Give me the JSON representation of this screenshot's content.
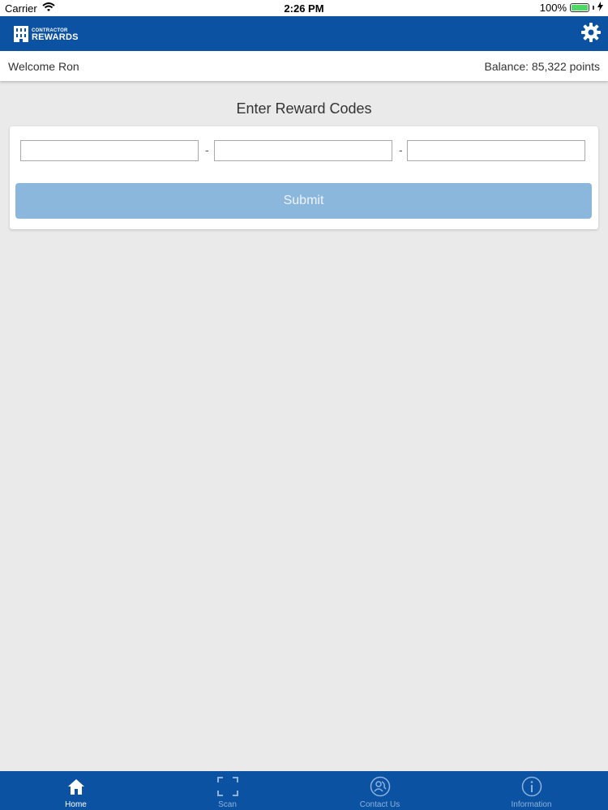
{
  "status_bar": {
    "carrier": "Carrier",
    "time": "2:26 PM",
    "battery_percent": "100%"
  },
  "header": {
    "logo_top": "CONTRACTOR",
    "logo_bottom": "REWARDS",
    "settings_icon": "gear-icon"
  },
  "welcome": {
    "greeting": "Welcome Ron",
    "balance": "Balance: 85,322 points"
  },
  "main": {
    "title": "Enter Reward Codes",
    "code_separator": "-",
    "submit_label": "Submit"
  },
  "tabs": [
    {
      "label": "Home",
      "icon": "home-icon",
      "active": true
    },
    {
      "label": "Scan",
      "icon": "scan-icon",
      "active": false
    },
    {
      "label": "Contact Us",
      "icon": "contact-icon",
      "active": false
    },
    {
      "label": "Information",
      "icon": "info-icon",
      "active": false
    }
  ],
  "colors": {
    "brand_blue": "#0c52a3",
    "submit_disabled": "#8bb7dd",
    "background": "#ebeaeb",
    "tab_inactive": "#8fb3db"
  }
}
